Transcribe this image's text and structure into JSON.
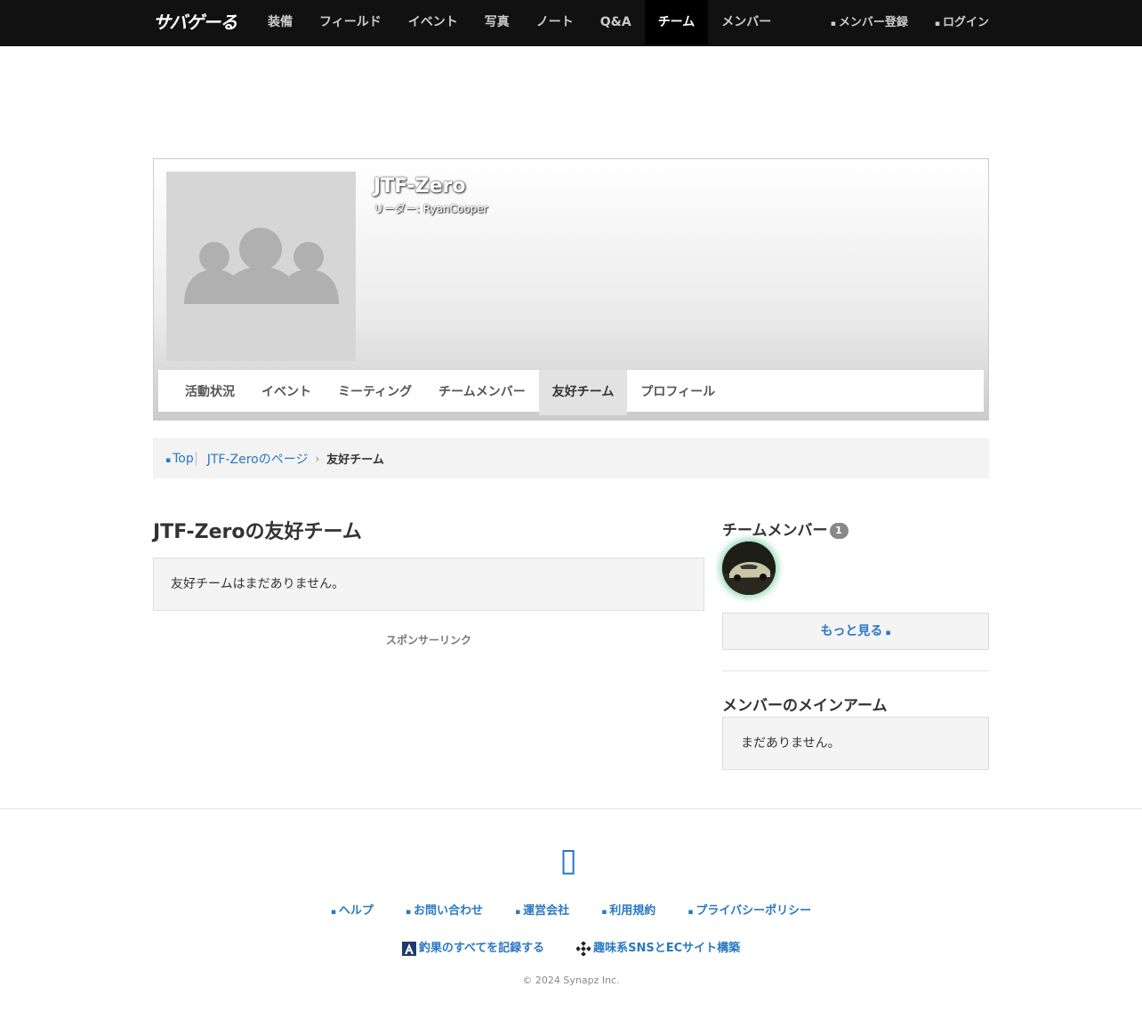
{
  "header": {
    "logo_text": "サバゲーる",
    "nav_items": [
      "装備",
      "フィールド",
      "イベント",
      "写真",
      "ノート",
      "Q&A",
      "チーム",
      "メンバー"
    ],
    "active_nav": "チーム",
    "register_label": "メンバー登録",
    "login_label": "ログイン"
  },
  "team": {
    "name": "JTF-Zero",
    "leader": "リーダー: RyanCooper",
    "tabs": [
      "活動状況",
      "イベント",
      "ミーティング",
      "チームメンバー",
      "友好チーム",
      "プロフィール"
    ],
    "active_tab": "友好チーム"
  },
  "breadcrumb": {
    "top": "Top",
    "team_page": "JTF-Zeroのページ",
    "current": "友好チーム"
  },
  "main": {
    "title": "JTF-Zeroの友好チーム",
    "empty_message": "友好チームはまだありません。",
    "sponsor_label": "スポンサーリンク"
  },
  "sidebar": {
    "members_title": "チームメンバー",
    "members_count": "1",
    "more_label": "もっと見る",
    "main_arm_title": "メンバーのメインアーム",
    "main_arm_empty": "まだありません。"
  },
  "footer": {
    "links": [
      "ヘルプ",
      "お問い合わせ",
      "運営会社",
      "利用規約",
      "プライバシーポリシー"
    ],
    "sites": [
      "釣果のすべてを記録する",
      "趣味系SNSとECサイト構築"
    ],
    "copyright": "© 2024 Synapz Inc."
  },
  "colors": {
    "link": "#2a78c2",
    "nav_bg": "#111111",
    "avatar_glow": "#60c896"
  }
}
